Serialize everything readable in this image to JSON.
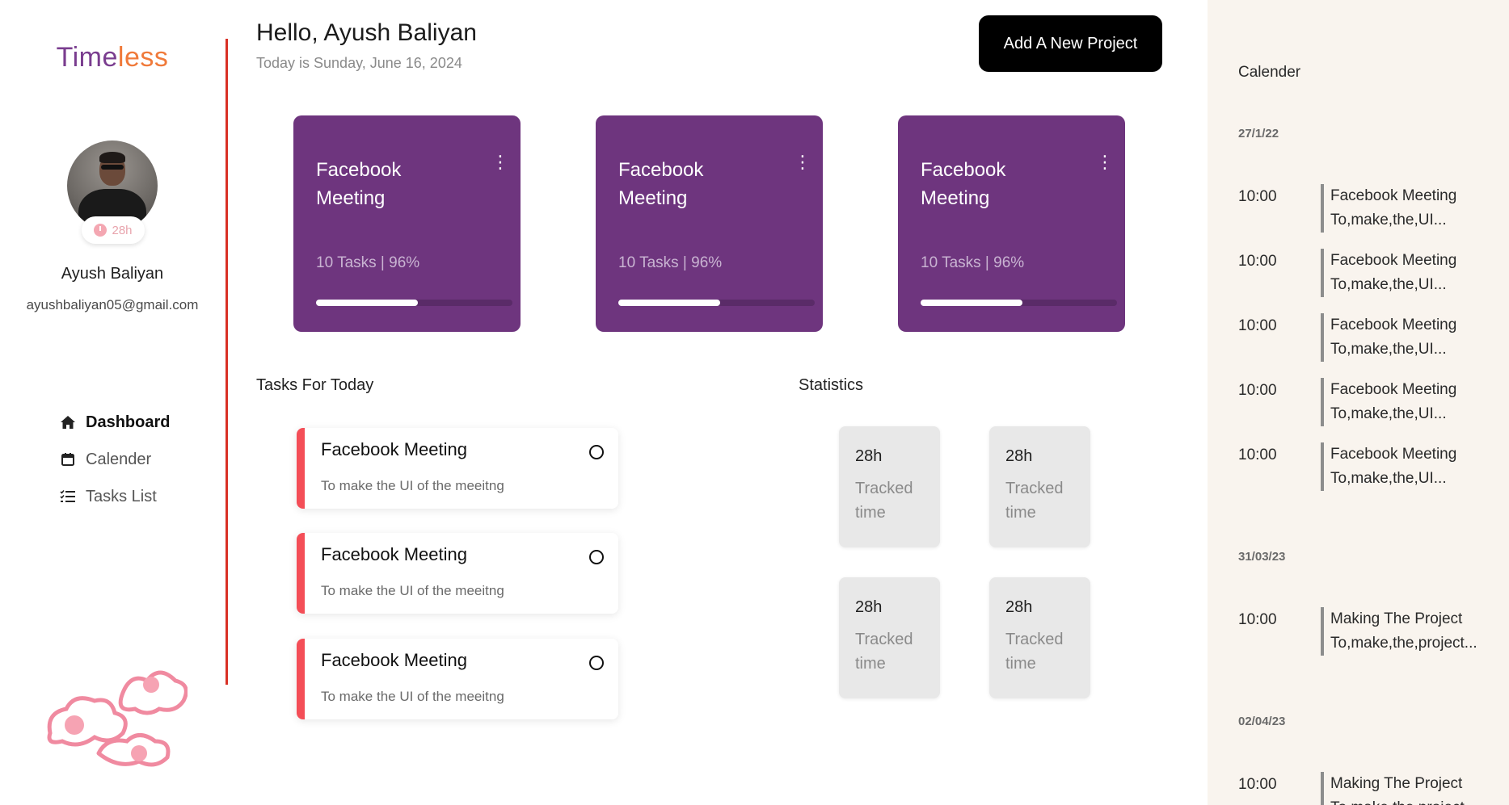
{
  "sidebar": {
    "logo_part1": "Time",
    "logo_part2": "less",
    "avatar_chip": "28h",
    "user_name": "Ayush Baliyan",
    "user_email": "ayushbaliyan05@gmail.com",
    "nav": [
      {
        "label": "Dashboard",
        "icon": "home-icon",
        "active": true
      },
      {
        "label": "Calender",
        "icon": "calendar-icon",
        "active": false
      },
      {
        "label": "Tasks List",
        "icon": "list-icon",
        "active": false
      }
    ]
  },
  "header": {
    "greeting": "Hello, Ayush Baliyan",
    "date_line": "Today is Sunday, June 16, 2024",
    "add_button": "Add A New Project"
  },
  "projects": [
    {
      "title": "Facebook Meeting",
      "meta": "10 Tasks | 96%",
      "progress": 0.52
    },
    {
      "title": "Facebook Meeting",
      "meta": "10 Tasks | 96%",
      "progress": 0.52
    },
    {
      "title": "Facebook Meeting",
      "meta": "10 Tasks | 96%",
      "progress": 0.52
    }
  ],
  "tasks_section": {
    "title": "Tasks For Today",
    "items": [
      {
        "title": "Facebook Meeting",
        "desc": "To make the UI of the meeitng"
      },
      {
        "title": "Facebook Meeting",
        "desc": "To make the UI of the meeitng"
      },
      {
        "title": "Facebook Meeting",
        "desc": "To make the UI of the meeitng"
      }
    ]
  },
  "statistics": {
    "title": "Statistics",
    "items": [
      {
        "value": "28h",
        "label": "Tracked time"
      },
      {
        "value": "28h",
        "label": "Tracked time"
      },
      {
        "value": "28h",
        "label": "Tracked time"
      },
      {
        "value": "28h",
        "label": "Tracked time"
      }
    ]
  },
  "calendar_panel": {
    "title": "Calender",
    "groups": [
      {
        "date": "27/1/22",
        "events": [
          {
            "time": "10:00",
            "title": "Facebook Meeting",
            "desc": "To,make,the,UI..."
          },
          {
            "time": "10:00",
            "title": "Facebook Meeting",
            "desc": "To,make,the,UI..."
          },
          {
            "time": "10:00",
            "title": "Facebook Meeting",
            "desc": "To,make,the,UI..."
          },
          {
            "time": "10:00",
            "title": "Facebook Meeting",
            "desc": "To,make,the,UI..."
          },
          {
            "time": "10:00",
            "title": "Facebook Meeting",
            "desc": "To,make,the,UI..."
          }
        ]
      },
      {
        "date": "31/03/23",
        "events": [
          {
            "time": "10:00",
            "title": "Making The Project",
            "desc": "To,make,the,project..."
          }
        ]
      },
      {
        "date": "02/04/23",
        "events": [
          {
            "time": "10:00",
            "title": "Making The Project",
            "desc": "To,make,the,project..."
          }
        ]
      }
    ]
  },
  "colors": {
    "accent_purple": "#6e357e",
    "logo_orange": "#f07a3a",
    "task_red": "#f44e57",
    "divider_red": "#d93025",
    "panel_bg": "#f9f4ee"
  }
}
